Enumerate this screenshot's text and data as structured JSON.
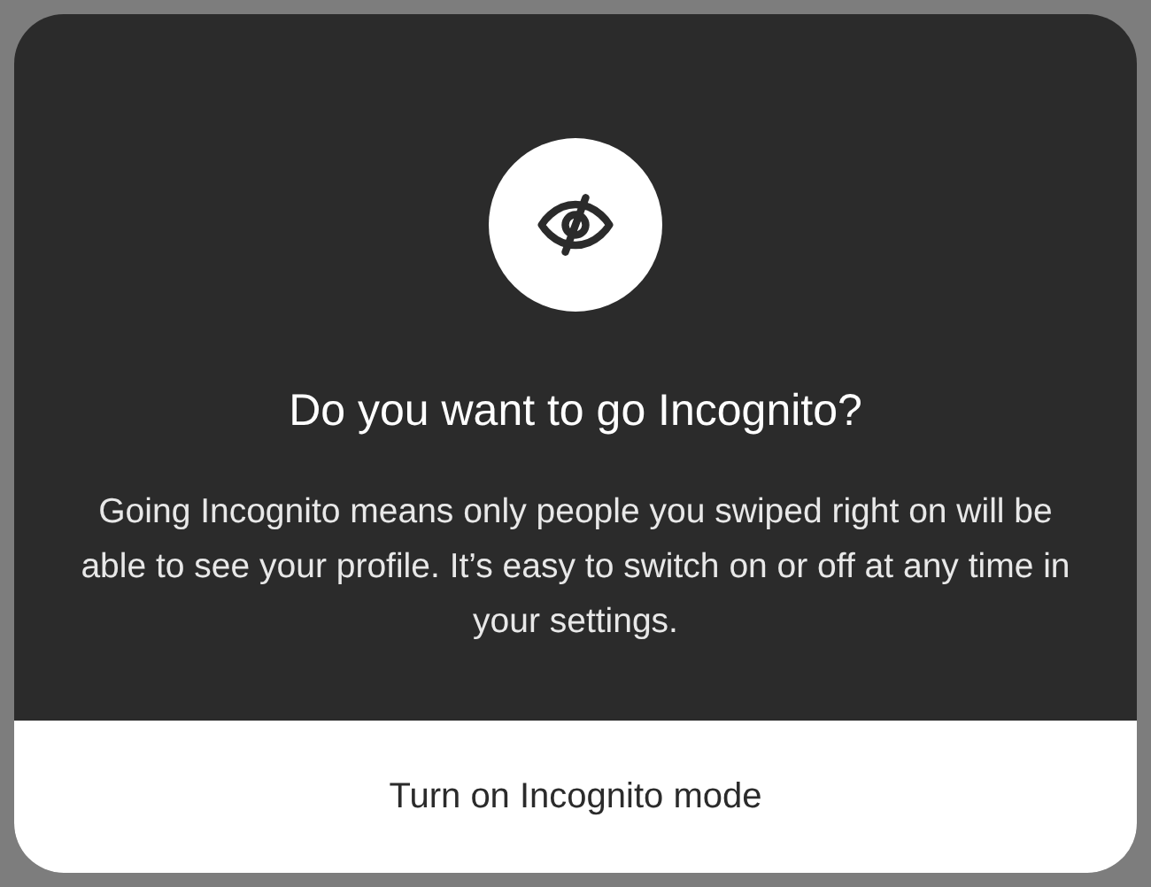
{
  "dialog": {
    "title": "Do you want to go Incognito?",
    "message": "Going Incognito means only people you swiped right on will be able to see your profile. It’s easy to switch on or off at any time in your settings.",
    "button": "Turn on Incognito mode"
  }
}
